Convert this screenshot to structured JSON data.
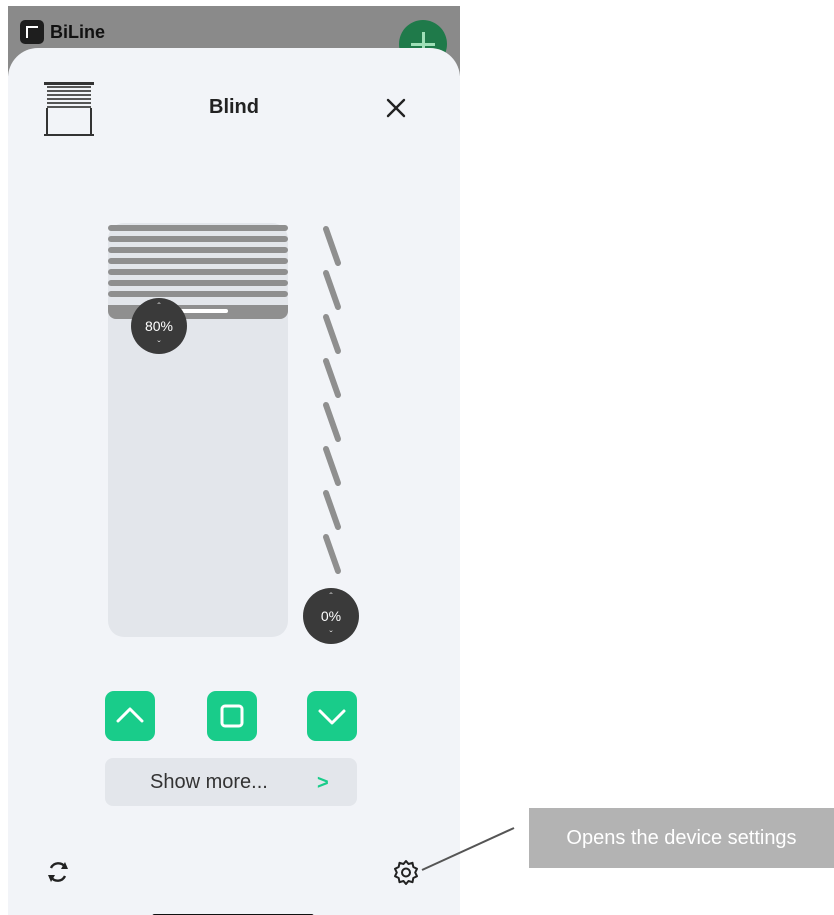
{
  "app": {
    "title": "BiLine",
    "add_icon": "plus-icon"
  },
  "sheet": {
    "title": "Blind",
    "device_icon": "blind-icon",
    "close_icon": "close-icon"
  },
  "blind": {
    "position_label": "80%",
    "position_value": 80,
    "tilt_label": "0%",
    "tilt_value": 0
  },
  "controls": {
    "up_icon": "chevron-up-icon",
    "stop_icon": "stop-icon",
    "down_icon": "chevron-down-icon"
  },
  "show_more": {
    "label": "Show more...",
    "chevron": ">"
  },
  "footer": {
    "refresh_icon": "refresh-icon",
    "settings_icon": "gear-icon"
  },
  "callout": {
    "text": "Opens the device settings"
  },
  "colors": {
    "accent": "#19cc8a",
    "knob": "#3a3a3a",
    "slat": "#8f8f8f"
  }
}
